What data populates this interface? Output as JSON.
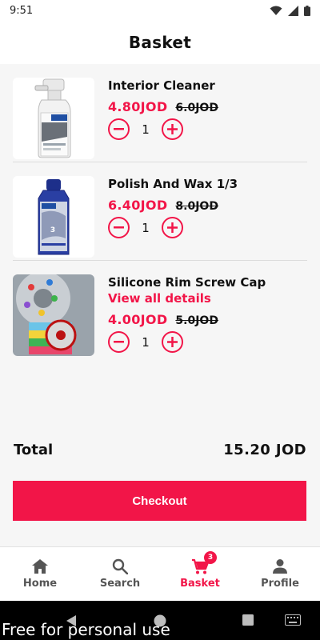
{
  "status_bar": {
    "time": "9:51"
  },
  "header": {
    "title": "Basket"
  },
  "items": [
    {
      "name": "Interior Cleaner",
      "details_link": "",
      "price": "4.80JOD",
      "old_price": "6.0JOD",
      "quantity": "1",
      "image": "spray-bottle-product-image"
    },
    {
      "name": "Polish And Wax 1/3",
      "details_link": "",
      "price": "6.40JOD",
      "old_price": "8.0JOD",
      "quantity": "1",
      "image": "polish-bottle-product-image"
    },
    {
      "name": "Silicone Rim Screw Cap",
      "details_link": "View all details",
      "price": "4.00JOD",
      "old_price": "5.0JOD",
      "quantity": "1",
      "image": "rim-caps-product-image"
    }
  ],
  "summary": {
    "total_label": "Total",
    "total_value": "15.20 JOD"
  },
  "checkout_label": "Checkout",
  "bottom_nav": {
    "items": [
      {
        "label": "Home",
        "icon": "home-icon"
      },
      {
        "label": "Search",
        "icon": "search-icon"
      },
      {
        "label": "Basket",
        "icon": "cart-icon",
        "badge": "3",
        "active": true
      },
      {
        "label": "Profile",
        "icon": "person-icon"
      }
    ]
  },
  "watermark": "Free for personal use",
  "colors": {
    "accent": "#f21548",
    "background": "#f6f6f6"
  }
}
